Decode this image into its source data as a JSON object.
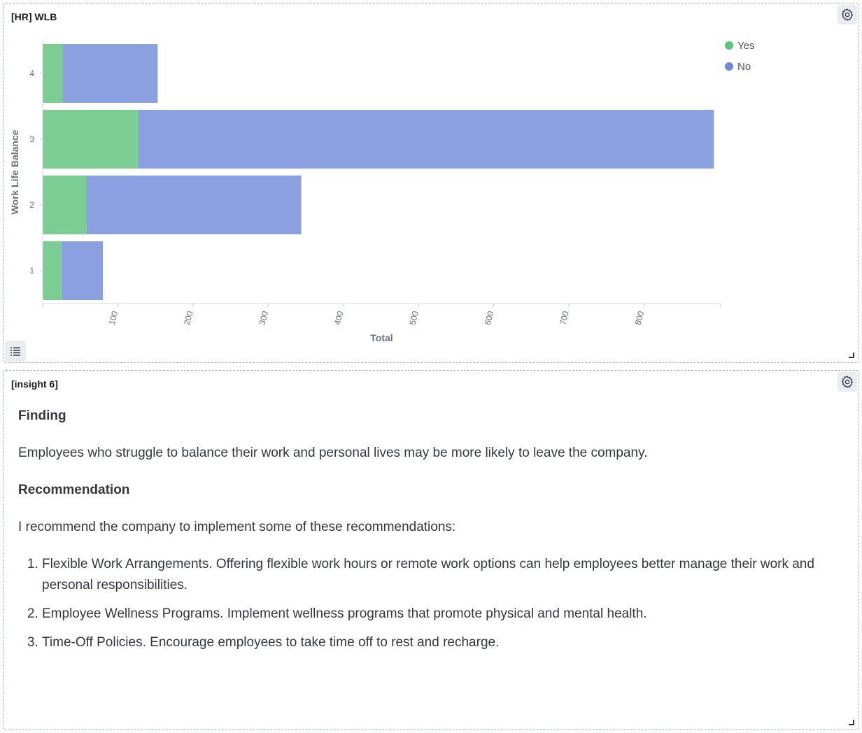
{
  "panels": [
    {
      "title": "[HR] WLB",
      "legend": [
        {
          "label": "Yes",
          "color": "#7ccd94"
        },
        {
          "label": "No",
          "color": "#8ba0e0"
        }
      ]
    },
    {
      "title": "[insight 6]",
      "finding_heading": "Finding",
      "finding_text": "Employees who struggle to balance their work and personal lives may be more likely to leave the company.",
      "recommendation_heading": "Recommendation",
      "recommendation_intro": "I recommend the company to implement some of these recommendations:",
      "recommendations": [
        "Flexible Work Arrangements. Offering flexible work hours or remote work options can help employees better manage their work and personal responsibilities.",
        "Employee Wellness Programs. Implement wellness programs that promote physical and mental health.",
        "Time-Off Policies. Encourage employees to take time off to rest and recharge."
      ]
    }
  ],
  "icons": {
    "gear": "gear-icon",
    "legend_toggle": "list-icon",
    "resize": "resize-handle-icon"
  },
  "chart_data": {
    "type": "bar",
    "orientation": "horizontal",
    "stacked": true,
    "title": "",
    "xlabel": "Total",
    "ylabel": "Work Life Balance",
    "categories": [
      "4",
      "3",
      "2",
      "1"
    ],
    "series": [
      {
        "name": "Yes",
        "color": "#7ccd94",
        "values": [
          27,
          127,
          58,
          25
        ]
      },
      {
        "name": "No",
        "color": "#8ba0e0",
        "values": [
          126,
          766,
          286,
          55
        ]
      }
    ],
    "x_ticks": [
      "100",
      "200",
      "300",
      "400",
      "500",
      "600",
      "700",
      "800"
    ],
    "xlim": [
      0,
      902
    ],
    "legend_position": "top-right",
    "grid": false
  }
}
